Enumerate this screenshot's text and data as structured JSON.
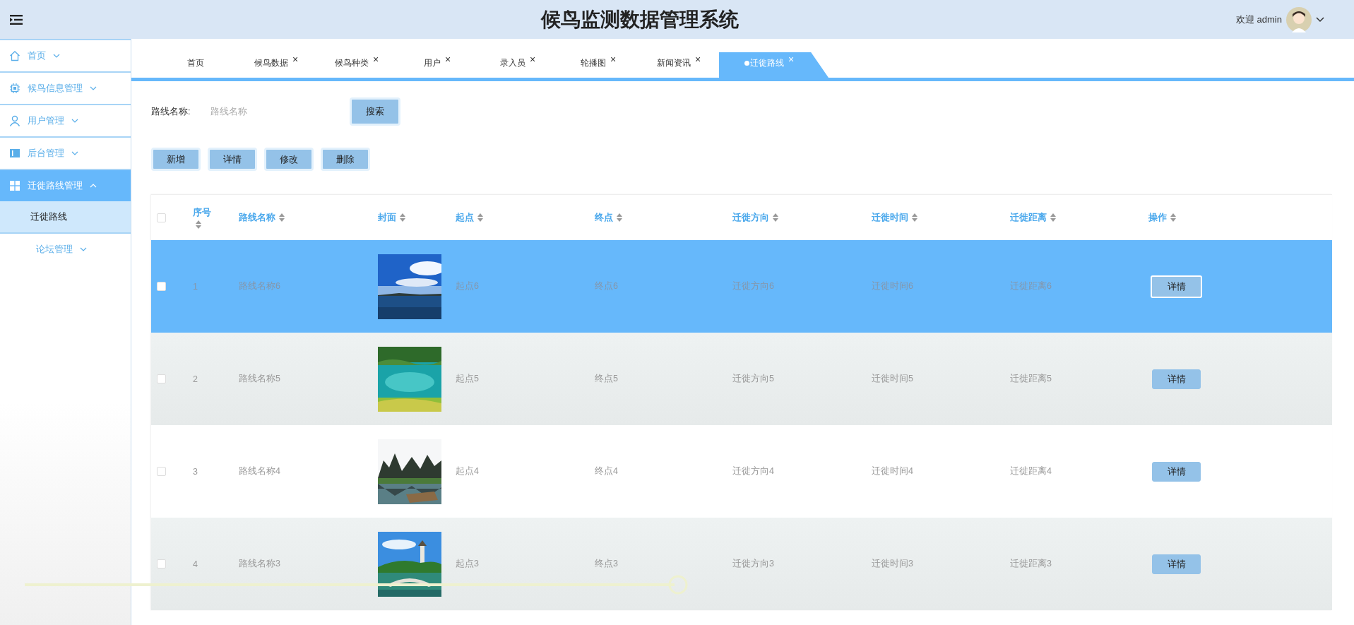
{
  "header": {
    "title": "候鸟监测数据管理系统",
    "welcome": "欢迎 admin"
  },
  "sidebar": {
    "items": [
      {
        "label": "首页",
        "kind": "home",
        "selected": false,
        "expanded": false
      },
      {
        "label": "候鸟信息管理",
        "kind": "chip",
        "selected": false,
        "expanded": false
      },
      {
        "label": "用户管理",
        "kind": "user",
        "selected": false,
        "expanded": false
      },
      {
        "label": "后台管理",
        "kind": "panel",
        "selected": false,
        "expanded": false
      },
      {
        "label": "迁徙路线管理",
        "kind": "grid",
        "selected": true,
        "expanded": true,
        "children": [
          {
            "label": "迁徙路线",
            "selected": true
          }
        ]
      },
      {
        "label": "论坛管理",
        "kind": "plain",
        "selected": false,
        "expanded": false
      }
    ]
  },
  "tabs": [
    {
      "label": "首页",
      "selected": false
    },
    {
      "label": "候鸟数据",
      "close": "×",
      "selected": false
    },
    {
      "label": "候鸟种类",
      "close": "×",
      "selected": false
    },
    {
      "label": "用户",
      "close": "×",
      "selected": false
    },
    {
      "label": "录入员",
      "close": "×",
      "selected": false
    },
    {
      "label": "轮播图",
      "close": "×",
      "selected": false
    },
    {
      "label": "新闻资讯",
      "close": "×",
      "selected": false
    },
    {
      "label": "迁徙路线",
      "close": "×",
      "selected": true
    }
  ],
  "search": {
    "label": "路线名称:",
    "placeholder": "路线名称",
    "button": "搜索"
  },
  "actions": [
    "新增",
    "详情",
    "修改",
    "删除"
  ],
  "table": {
    "all_checked": false,
    "columns": [
      "序号",
      "路线名称",
      "封面",
      "起点",
      "终点",
      "迁徙方向",
      "迁徙时间",
      "迁徙距离",
      "操作"
    ],
    "rows": [
      {
        "selected": true,
        "checked": false,
        "cells": [
          "1",
          "路线名称6",
          null,
          "起点6",
          "终点6",
          "迁徙方向6",
          "迁徙时间6",
          "迁徙距离6"
        ],
        "action": "详情"
      },
      {
        "selected": false,
        "checked": false,
        "cells": [
          "2",
          "路线名称5",
          null,
          "起点5",
          "终点5",
          "迁徙方向5",
          "迁徙时间5",
          "迁徙距离5"
        ],
        "action": "详情"
      },
      {
        "selected": false,
        "checked": false,
        "cells": [
          "3",
          "路线名称4",
          null,
          "起点4",
          "终点4",
          "迁徙方向4",
          "迁徙时间4",
          "迁徙距离4"
        ],
        "action": "详情"
      },
      {
        "selected": false,
        "checked": false,
        "cells": [
          "4",
          "路线名称3",
          null,
          "起点3",
          "终点3",
          "迁徙方向3",
          "迁徙时间3",
          "迁徙距离3"
        ],
        "action": "详情"
      }
    ]
  }
}
